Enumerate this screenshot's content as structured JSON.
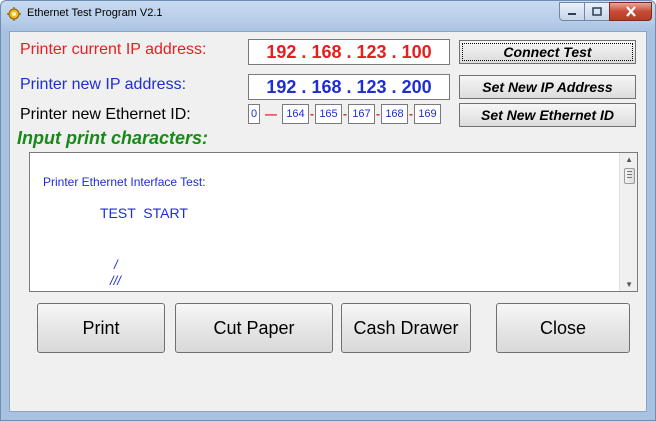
{
  "window": {
    "title": "Ethernet Test Program  V2.1"
  },
  "labels": {
    "current_ip": "Printer current IP address:",
    "new_ip": "Printer new IP address:",
    "new_eth": "Printer new Ethernet ID:"
  },
  "current_ip": {
    "o1": "192",
    "o2": "168",
    "o3": "123",
    "o4": "100",
    "sep": "."
  },
  "new_ip": {
    "o1": "192",
    "o2": "168",
    "o3": "123",
    "o4": "200",
    "sep": "."
  },
  "ethernet_id": {
    "parts": [
      "0",
      "164",
      "165",
      "167",
      "168",
      "169"
    ]
  },
  "buttons": {
    "connect_test": "Connect Test",
    "set_new_ip": "Set New IP Address",
    "set_new_eth": "Set New Ethernet ID",
    "print": "Print",
    "cut_paper": "Cut Paper",
    "cash_drawer": "Cash Drawer",
    "close": "Close"
  },
  "input_heading": "Input print characters:",
  "print_text": {
    "line1": "Printer Ethernet Interface Test:",
    "line2": "TEST  START",
    "line3": "/",
    "line4": "///"
  },
  "colors": {
    "red": "#e51f1f",
    "blue": "#1e2dd4",
    "green": "#178a17"
  }
}
